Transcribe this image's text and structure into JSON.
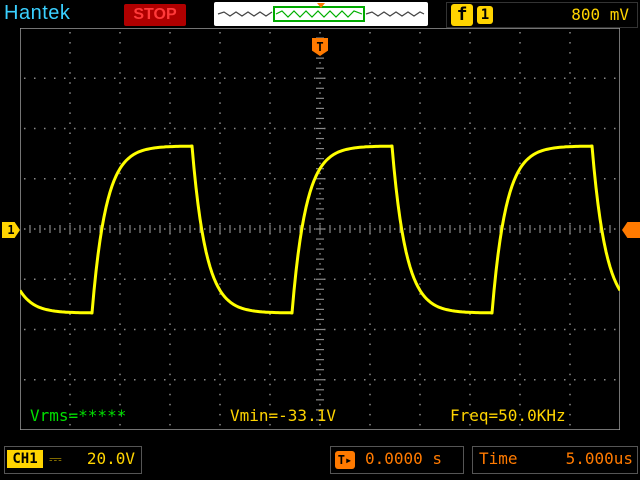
{
  "brand": "Hantek",
  "run_state": "STOP",
  "trigger": {
    "edge_icon": "rising-edge-icon",
    "edge_glyph": "f",
    "channel": "1",
    "level": "800 mV",
    "position_marker": "T"
  },
  "channel1": {
    "tag": "CH1",
    "coupling_glyph": "⎓",
    "volts_per_div": "20.0V",
    "marker": "1"
  },
  "trigger_offset": {
    "icon": "trigger-position-icon",
    "glyph": "T▸",
    "value": "0.0000 s"
  },
  "timebase": {
    "label": "Time",
    "value": "5.000us"
  },
  "measurements": {
    "vrms": "Vrms=*****",
    "vmin": "Vmin=-33.1V",
    "freq": "Freq=50.0KHz"
  },
  "colors": {
    "trace": "#ffff00",
    "accent": "#ff7a00",
    "brand": "#3ad0ff",
    "stop": "#b00000",
    "measure_green": "#00e000"
  }
}
